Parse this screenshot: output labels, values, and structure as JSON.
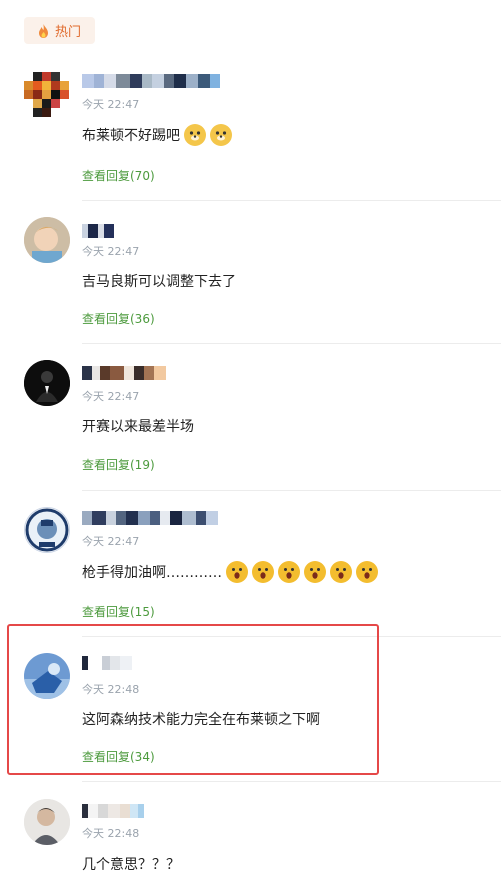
{
  "section": {
    "label": "热门",
    "icon": "fire-icon"
  },
  "comments": [
    {
      "time": "今天 22:47",
      "text": "布莱顿不好踢吧",
      "reply": "查看回复(70)",
      "emoji_count": 2,
      "emoji": "doge-emoji"
    },
    {
      "time": "今天 22:47",
      "text": "吉马良斯可以调整下去了",
      "reply": "查看回复(36)"
    },
    {
      "time": "今天 22:47",
      "text": "开赛以来最差半场",
      "reply": "查看回复(19)"
    },
    {
      "time": "今天 22:47",
      "text": "枪手得加油啊…………",
      "reply": "查看回复(15)",
      "emoji_count": 6,
      "emoji": "shocked-emoji"
    },
    {
      "time": "今天 22:48",
      "text": "这阿森纳技术能力完全在布莱顿之下啊",
      "reply": "查看回复(34)",
      "highlighted": true
    },
    {
      "time": "今天 22:48",
      "text": "几个意思？？？"
    }
  ],
  "colors": {
    "accent_green": "#4c9a3d",
    "hot_orange": "#e06a2c",
    "highlight_red": "#e54848"
  }
}
